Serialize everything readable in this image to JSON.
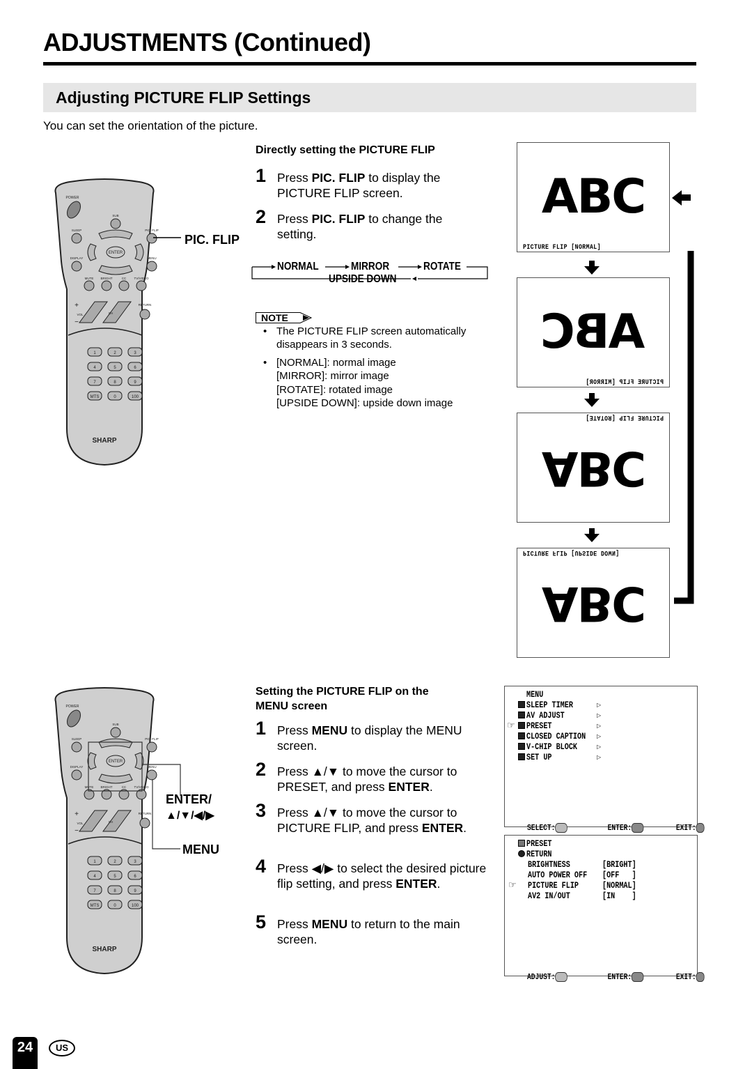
{
  "page": {
    "title": "ADJUSTMENTS (Continued)",
    "section_title": "Adjusting PICTURE FLIP Settings",
    "intro": "You can set the orientation of the picture.",
    "page_number": "24",
    "region_badge": "US"
  },
  "direct": {
    "heading": "Directly setting the PICTURE FLIP",
    "steps": [
      {
        "num": "1",
        "pre": "Press ",
        "bold": "PIC. FLIP",
        "post": " to display the PICTURE FLIP screen."
      },
      {
        "num": "2",
        "pre": "Press ",
        "bold": "PIC. FLIP",
        "post": " to change the setting."
      }
    ],
    "flow": {
      "normal": "NORMAL",
      "mirror": "MIRROR",
      "rotate": "ROTATE",
      "upside_down": "UPSIDE DOWN"
    },
    "note_label": "NOTE",
    "notes": [
      {
        "lines": [
          "The PICTURE FLIP screen automatically",
          "disappears in 3 seconds."
        ]
      },
      {
        "lines": [
          "[NORMAL]: normal image",
          "[MIRROR]: mirror image",
          "[ROTATE]: rotated image",
          "[UPSIDE DOWN]: upside down image"
        ]
      }
    ],
    "remote_label": "PIC. FLIP"
  },
  "screens": [
    {
      "text": "ABC",
      "osd": "PICTURE FLIP [NORMAL]",
      "mode": "normal"
    },
    {
      "text": "ABC",
      "osd": "PICTURE FLIP [MIRROR]",
      "mode": "mirror"
    },
    {
      "text": "ABC",
      "osd": "PICTURE FLIP [ROTATE]",
      "mode": "rotate"
    },
    {
      "text": "ABC",
      "osd": "PICTURE FLIP [UPSIDE DOWN]",
      "mode": "upside"
    }
  ],
  "menu_section": {
    "heading_line1": "Setting the PICTURE FLIP on the",
    "heading_line2": "MENU screen",
    "steps": [
      {
        "num": "1",
        "html_parts": [
          [
            "Press ",
            false
          ],
          [
            "MENU",
            true
          ],
          [
            " to display the MENU screen.",
            false
          ]
        ]
      },
      {
        "num": "2",
        "html_parts": [
          [
            "Press ▲/▼ to move the cursor to PRESET, and press ",
            false
          ],
          [
            "ENTER",
            true
          ],
          [
            ".",
            false
          ]
        ]
      },
      {
        "num": "3",
        "html_parts": [
          [
            "Press ▲/▼ to move the cursor to PICTURE FLIP, and press ",
            false
          ],
          [
            "ENTER",
            true
          ],
          [
            ".",
            false
          ]
        ]
      },
      {
        "num": "4",
        "html_parts": [
          [
            "Press ◀/▶ to select the desired picture flip setting, and press ",
            false
          ],
          [
            "ENTER",
            true
          ],
          [
            ".",
            false
          ]
        ]
      },
      {
        "num": "5",
        "html_parts": [
          [
            "Press ",
            false
          ],
          [
            "MENU",
            true
          ],
          [
            " to return to the main screen.",
            false
          ]
        ]
      }
    ],
    "remote_label_enter": "ENTER/",
    "remote_label_arrows": "▲/▼/◀/▶",
    "remote_label_menu": "MENU"
  },
  "menu_screen": {
    "title": "MENU",
    "items": [
      {
        "label": "SLEEP TIMER",
        "icon": "clock-icon",
        "selected": false
      },
      {
        "label": "AV ADJUST",
        "icon": "av-adjust-icon",
        "selected": false
      },
      {
        "label": "PRESET",
        "icon": "preset-icon",
        "selected": true
      },
      {
        "label": "CLOSED CAPTION",
        "icon": "cc-icon",
        "selected": false
      },
      {
        "label": "V-CHIP BLOCK",
        "icon": "lock-icon",
        "selected": false
      },
      {
        "label": "SET UP",
        "icon": "setup-icon",
        "selected": false
      }
    ],
    "footer": {
      "select": "SELECT:",
      "enter": "ENTER:",
      "exit": "EXIT:"
    }
  },
  "preset_screen": {
    "title": "PRESET",
    "return_label": "RETURN",
    "rows": [
      {
        "label": "BRIGHTNESS",
        "value": "[BRIGHT]",
        "selected": false
      },
      {
        "label": "AUTO POWER OFF",
        "value": "[OFF   ]",
        "selected": false
      },
      {
        "label": "PICTURE FLIP",
        "value": "[NORMAL]",
        "selected": true
      },
      {
        "label": "AV2 IN/OUT",
        "value": "[IN    ]",
        "selected": false
      }
    ],
    "footer": {
      "adjust": "ADJUST:",
      "enter": "ENTER:",
      "exit": "EXIT:"
    }
  },
  "remote": {
    "brand": "SHARP",
    "buttons": {
      "power": "POWER",
      "sub": "SUB",
      "sleep": "SLEEP",
      "pic_flip": "PIC. FLIP",
      "display": "DISPLAY",
      "menu": "MENU",
      "enter": "ENTER",
      "mute": "MUTE",
      "bright": "BRIGHT",
      "cc": "CC",
      "tv_video": "TV/VIDEO",
      "vol": "VOL",
      "ch": "CH",
      "return": "RETURN"
    },
    "keypad": [
      "1",
      "2",
      "3",
      "4",
      "5",
      "6",
      "7",
      "8",
      "9",
      "MTS",
      "0",
      "100"
    ]
  }
}
